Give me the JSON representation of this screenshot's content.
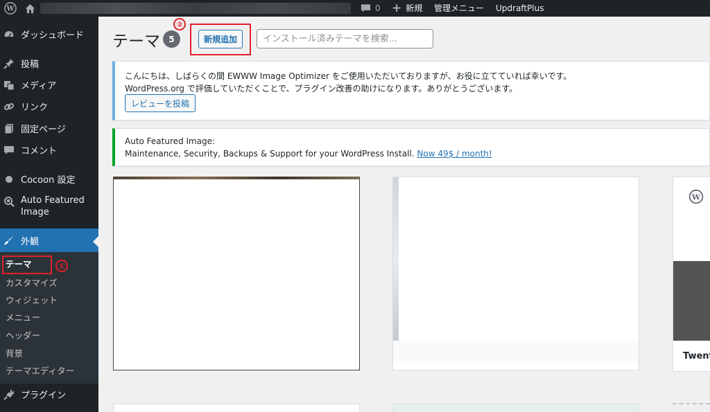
{
  "admin_bar": {
    "wp_logo_icon": "wordpress-logo-icon",
    "home_icon": "home-icon",
    "comment_count": "0",
    "new_label": "新規",
    "admin_menu_label": "管理メニュー",
    "updraft_label": "UpdraftPlus"
  },
  "sidebar": {
    "dashboard": "ダッシュボード",
    "posts": "投稿",
    "media": "メディア",
    "links": "リンク",
    "pages": "固定ページ",
    "comments": "コメント",
    "cocoon": "Cocoon 設定",
    "auto_featured_line1": "Auto Featured",
    "auto_featured_line2": "Image",
    "appearance": "外観",
    "submenu": {
      "themes": "テーマ",
      "customize": "カスタマイズ",
      "widgets": "ウィジェット",
      "menus": "メニュー",
      "header": "ヘッダー",
      "background": "背景",
      "theme_editor": "テーマエディター"
    },
    "plugins": "プラグイン"
  },
  "main": {
    "page_title": "テーマ",
    "theme_count": "5",
    "add_new_label": "新規追加",
    "search_placeholder": "インストール済みテーマを検索..."
  },
  "annotations": {
    "marker1": "①",
    "marker2": "②",
    "color": "#e0202b"
  },
  "notice_ewww": {
    "line1": "こんにちは、しばらくの間 EWWW Image Optimizer をご使用いただいておりますが、お役に立てていれば幸いです。",
    "line2": "WordPress.org で評価していただくことで、プラグイン改善の助けになります。ありがとうございます。",
    "button": "レビューを投稿"
  },
  "notice_afi": {
    "title": "Auto Featured Image:",
    "text": "Maintenance, Security, Backups & Support for your WordPress Install.",
    "link": "Now 49$ / month!"
  },
  "theme_cards": {
    "partial_name": "Twenty"
  },
  "colors": {
    "admin_bg": "#1d2327",
    "accent": "#2271b1",
    "submenu_bg": "#2c3338",
    "content_bg": "#f0f0f1"
  }
}
